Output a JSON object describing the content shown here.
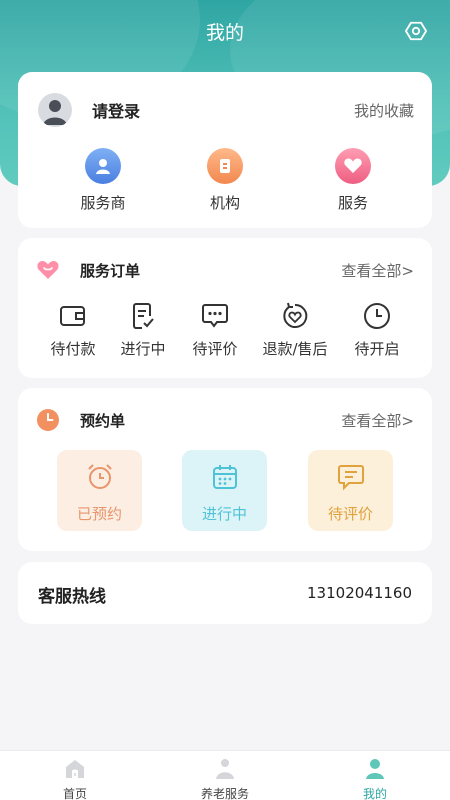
{
  "header": {
    "title": "我的"
  },
  "profile": {
    "login_text": "请登录",
    "favorites_label": "我的收藏",
    "quick_links": [
      {
        "label": "服务商",
        "icon": "provider-icon"
      },
      {
        "label": "机构",
        "icon": "institution-icon"
      },
      {
        "label": "服务",
        "icon": "service-heart-icon"
      }
    ]
  },
  "orders": {
    "title": "服务订单",
    "see_all": "查看全部>",
    "items": [
      {
        "label": "待付款",
        "icon": "wallet-icon"
      },
      {
        "label": "进行中",
        "icon": "checklist-icon"
      },
      {
        "label": "待评价",
        "icon": "comment-icon"
      },
      {
        "label": "退款/售后",
        "icon": "refund-icon"
      },
      {
        "label": "待开启",
        "icon": "clock-icon"
      }
    ]
  },
  "booking": {
    "title": "预约单",
    "see_all": "查看全部>",
    "items": [
      {
        "label": "已预约",
        "icon": "alarm-clock-icon"
      },
      {
        "label": "进行中",
        "icon": "calendar-icon"
      },
      {
        "label": "待评价",
        "icon": "message-icon"
      }
    ]
  },
  "hotline": {
    "label": "客服热线",
    "number": "13102041160"
  },
  "tabbar": {
    "tabs": [
      {
        "label": "首页",
        "icon": "home-icon"
      },
      {
        "label": "养老服务",
        "icon": "elderly-service-icon"
      },
      {
        "label": "我的",
        "icon": "user-icon"
      }
    ]
  },
  "colors": {
    "brand": "#2fa5a3",
    "booked": "#e8956b",
    "in_progress": "#4fc3d6",
    "to_review": "#e0a23c"
  }
}
